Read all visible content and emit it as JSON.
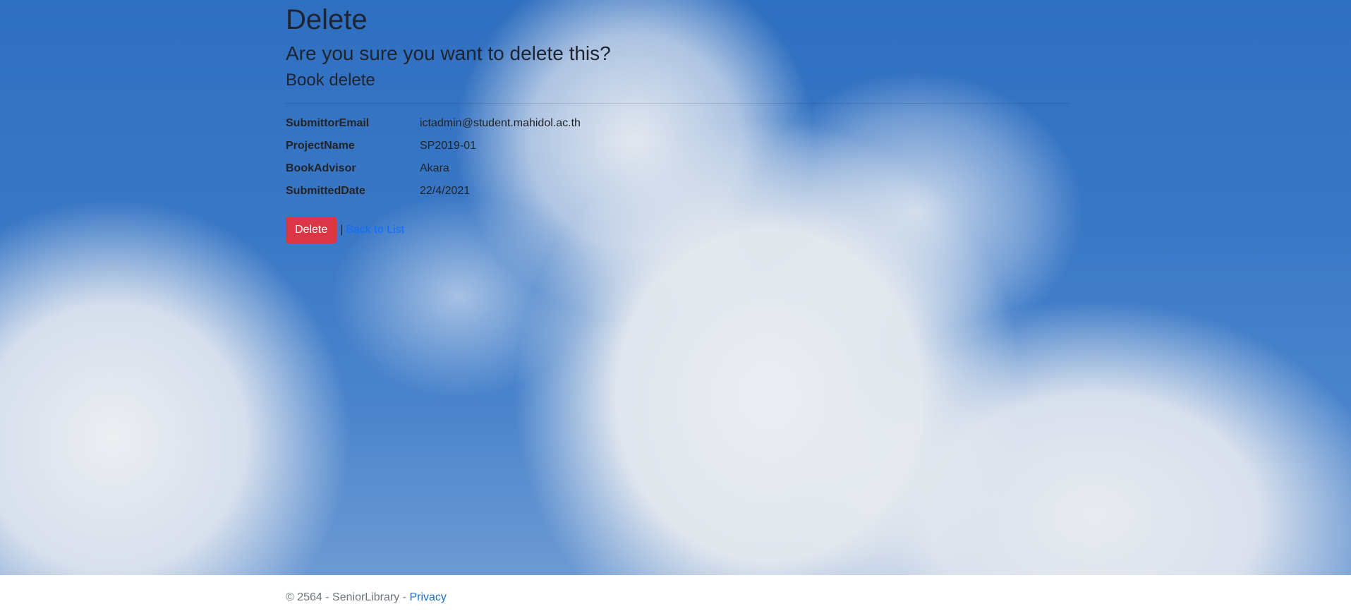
{
  "page": {
    "title": "Delete",
    "question": "Are you sure you want to delete this?",
    "subtitle": "Book delete"
  },
  "details": [
    {
      "label": "SubmittorEmail",
      "value": "ictadmin@student.mahidol.ac.th"
    },
    {
      "label": "ProjectName",
      "value": "SP2019-01"
    },
    {
      "label": "BookAdvisor",
      "value": "Akara"
    },
    {
      "label": "SubmittedDate",
      "value": "22/4/2021"
    }
  ],
  "actions": {
    "delete_label": "Delete",
    "separator": "|",
    "back_label": "Back to List"
  },
  "footer": {
    "copyright": "© 2564 - SeniorLibrary -",
    "privacy_label": "Privacy"
  },
  "colors": {
    "danger": "#dc3545",
    "link": "#0d6efd",
    "sky": "#2f6fc0"
  }
}
